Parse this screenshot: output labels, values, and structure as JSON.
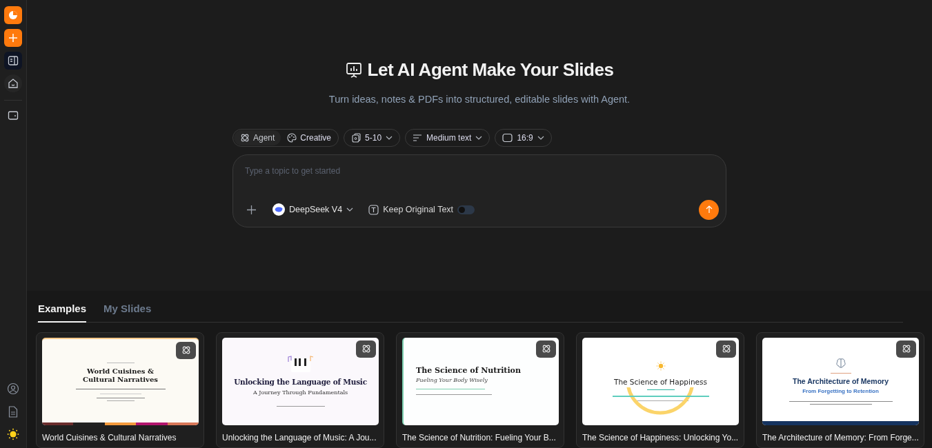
{
  "sidebar": {
    "top_buttons": [
      {
        "kind": "logo"
      },
      {
        "kind": "new"
      }
    ],
    "items": [
      {
        "kind": "slides",
        "selected": true
      },
      {
        "kind": "home",
        "selected": false
      },
      {
        "kind": "wallet",
        "selected": false
      }
    ],
    "bottom_items": [
      {
        "kind": "account"
      },
      {
        "kind": "document"
      },
      {
        "kind": "theme"
      }
    ]
  },
  "header": {
    "title": "Let AI Agent Make Your Slides",
    "subtitle": "Turn ideas, notes & PDFs into structured, editable slides with Agent."
  },
  "mode_toggle": [
    {
      "kind": "agent",
      "label": "Agent",
      "selected": true
    },
    {
      "kind": "creative",
      "label": "Creative",
      "selected": false
    }
  ],
  "dropdowns": [
    {
      "kind": "pages",
      "label": "5-10"
    },
    {
      "kind": "text",
      "label": "Medium text"
    },
    {
      "kind": "ratio",
      "label": "16:9"
    }
  ],
  "prompt": {
    "placeholder": "Type a topic to get started",
    "model": "DeepSeek V4",
    "keep_original_text": {
      "label": "Keep Original Text",
      "on": false
    }
  },
  "tabs": [
    {
      "label": "Examples",
      "selected": true
    },
    {
      "label": "My Slides",
      "selected": false
    }
  ],
  "examples": [
    {
      "title": "World Cuisines & Cultural Narratives",
      "slide": {
        "kind": "cuisine",
        "title": "World Cuisines & Cultural Narratives"
      }
    },
    {
      "title": "Unlocking the Language of Music: A Jou...",
      "slide": {
        "kind": "music",
        "title": "Unlocking the Language of Music",
        "subtitle": "A Journey Through Fundamentals"
      }
    },
    {
      "title": "The Science of Nutrition: Fueling Your B...",
      "slide": {
        "kind": "nutrition",
        "title": "The Science of Nutrition",
        "subtitle": "Fueling Your Body Wisely"
      }
    },
    {
      "title": "The Science of Happiness: Unlocking Yo...",
      "slide": {
        "kind": "happiness",
        "title": "The Science of Happiness"
      }
    },
    {
      "title": "The Architecture of Memory: From Forge...",
      "slide": {
        "kind": "memory",
        "title": "The Architecture of Memory",
        "subtitle": "From Forgetting to Retention"
      }
    }
  ]
}
